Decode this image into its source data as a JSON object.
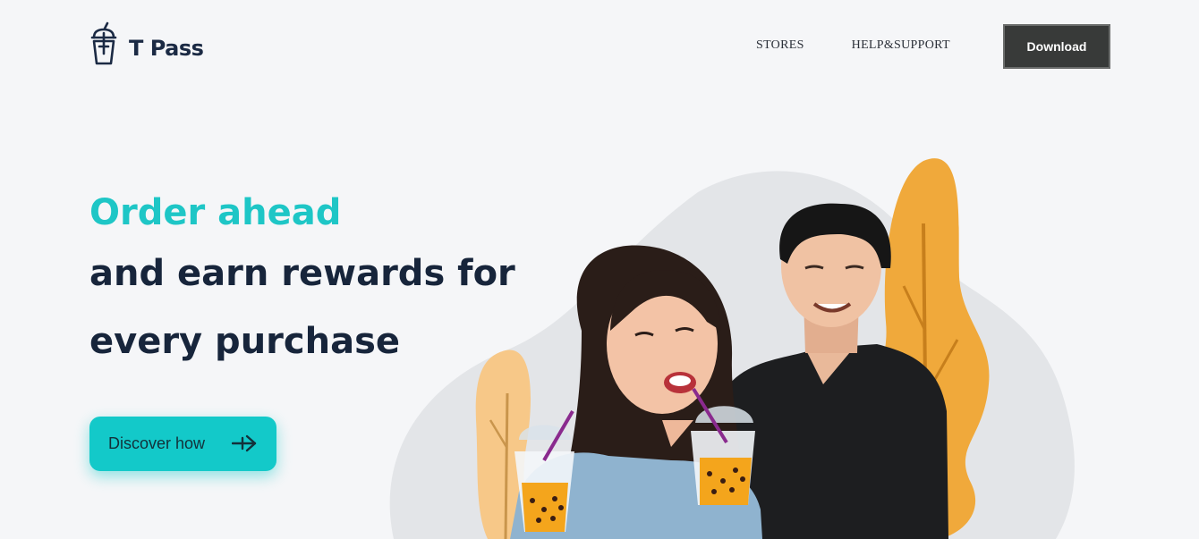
{
  "brand": {
    "name": "T Pass"
  },
  "nav": {
    "items": [
      {
        "label": "STORES"
      },
      {
        "label": "HELP&SUPPORT"
      }
    ],
    "download_label": "Download"
  },
  "hero": {
    "accent_line": "Order ahead",
    "lines": [
      "and earn rewards for",
      "every purchase"
    ],
    "cta_label": "Discover how"
  },
  "colors": {
    "accent": "#1ec6c6",
    "heading": "#17253b",
    "cta": "#13c9c9",
    "download_bg": "#383a39",
    "tree": "#f0a93b",
    "blob": "#e3e5e8"
  },
  "icons": {
    "logo": "bubble-tea-cup-icon",
    "cta_arrow": "arrow-right-icon"
  }
}
